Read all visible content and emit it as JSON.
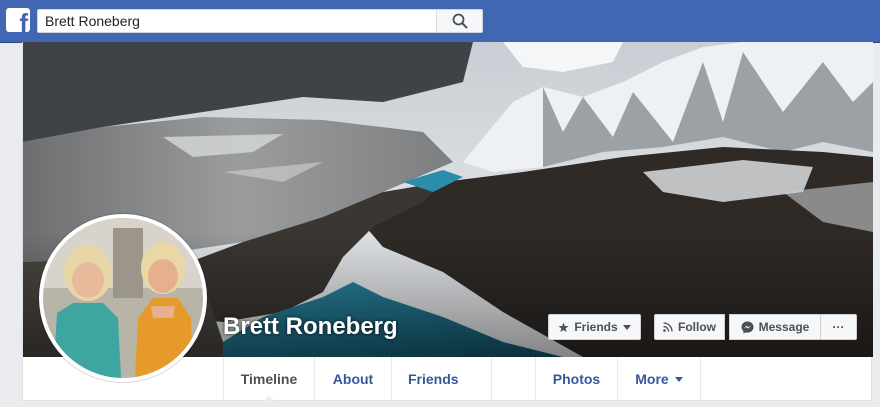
{
  "topbar": {
    "logo": "f",
    "search": {
      "value": "Brett Roneberg",
      "icon": "search-icon"
    }
  },
  "profile": {
    "name": "Brett Roneberg",
    "actions": {
      "friends_label": "Friends",
      "follow_label": "Follow",
      "message_label": "Message",
      "more_label": "···"
    },
    "tabs": [
      {
        "label": "Timeline",
        "active": true
      },
      {
        "label": "About"
      },
      {
        "label": "Friends"
      },
      {
        "label": ""
      },
      {
        "label": "Photos"
      },
      {
        "label": "More"
      }
    ]
  },
  "colors": {
    "brand": "#4267b2",
    "link": "#365899"
  }
}
